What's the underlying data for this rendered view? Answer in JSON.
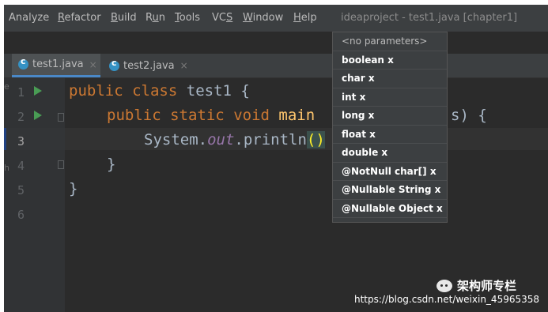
{
  "menubar": {
    "items": [
      {
        "label": "Analyze"
      },
      {
        "label": "Refactor"
      },
      {
        "label": "Build"
      },
      {
        "label": "Run"
      },
      {
        "label": "Tools"
      },
      {
        "label": "VCS"
      },
      {
        "label": "Window"
      },
      {
        "label": "Help"
      }
    ],
    "window_title": "ideaproject - test1.java [chapter1]"
  },
  "tabs": [
    {
      "label": "test1.java",
      "close": "×",
      "icon": "class-file-icon",
      "active": true
    },
    {
      "label": "test2.java",
      "close": "×",
      "icon": "class-file-icon",
      "active": false
    }
  ],
  "editor": {
    "line_numbers": [
      "1",
      "2",
      "3",
      "4",
      "5",
      "6"
    ],
    "current_line": 3,
    "code": {
      "l1_public": "public",
      "l1_class": "class",
      "l1_name": "test1 {",
      "l2_public": "public",
      "l2_static": "static",
      "l2_void": "void",
      "l2_method": "main",
      "l2_tail": "s) {",
      "l3_system": "System.",
      "l3_out": "out",
      "l3_println": ".println",
      "l3_parens": "()",
      "l4_brace": "}",
      "l5_brace": "}"
    },
    "edge_letters": [
      "e",
      "h"
    ]
  },
  "parameter_info_popup": {
    "header": "<no parameters>",
    "items": [
      "boolean x",
      "char x",
      "int x",
      "long x",
      "float x",
      "double x",
      "@NotNull char[] x",
      "@Nullable String x",
      "@Nullable Object x"
    ]
  },
  "watermark": {
    "brand": "架构师专栏",
    "url": "https://blog.csdn.net/weixin_45965358"
  },
  "colors": {
    "background": "#2b2b2b",
    "keyword": "#cc7832",
    "method": "#ffc66d",
    "field": "#9876aa",
    "run_arrow": "#499c54",
    "active_tab_underline": "#4a88c7"
  }
}
